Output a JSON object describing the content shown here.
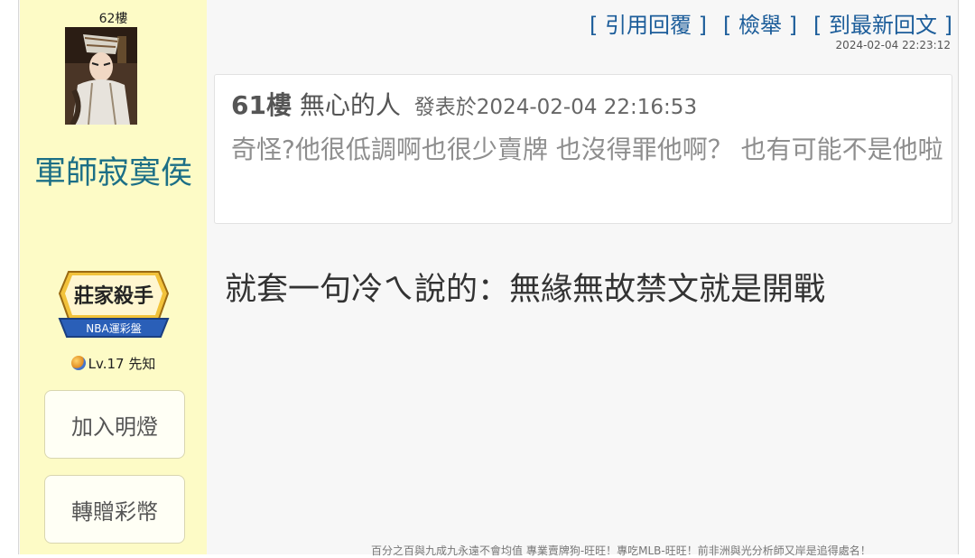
{
  "sidebar": {
    "floor_label": "62樓",
    "username": "軍師寂寞侯",
    "badge": {
      "line1": "莊家殺手",
      "line2": "NBA運彩盤"
    },
    "level": "Lv.17 先知",
    "buttons": {
      "add_light": "加入明燈",
      "gift_coins": "轉贈彩幣"
    }
  },
  "header": {
    "actions": [
      "[ 引用回覆 ]",
      "[ 檢舉 ]",
      "[ 到最新回文 ]"
    ],
    "timestamp": "2024-02-04 22:23:12"
  },
  "quote": {
    "floor": "61樓",
    "author": "無心的人",
    "posted_at": "發表於2024-02-04 22:16:53",
    "body": "奇怪?他很低調啊也很少賣牌 也沒得罪他啊？ 也有可能不是他啦"
  },
  "reply": {
    "text": "就套一句冷ㄟ說的：無緣無故禁文就是開戰"
  },
  "signature": "百分之百與九成九永遠不會均值 專業賣牌狗-旺旺！專吃MLB-旺旺！前非洲與光分析師又岸是追得處名！",
  "colors": {
    "sidebar_bg": "#fdfbc6",
    "username": "#1c6f86",
    "action_link": "#1c5d9a",
    "quote_text": "#8e8e8e"
  },
  "icons": [
    "user-avatar",
    "badge-emblem",
    "planet-icon"
  ]
}
